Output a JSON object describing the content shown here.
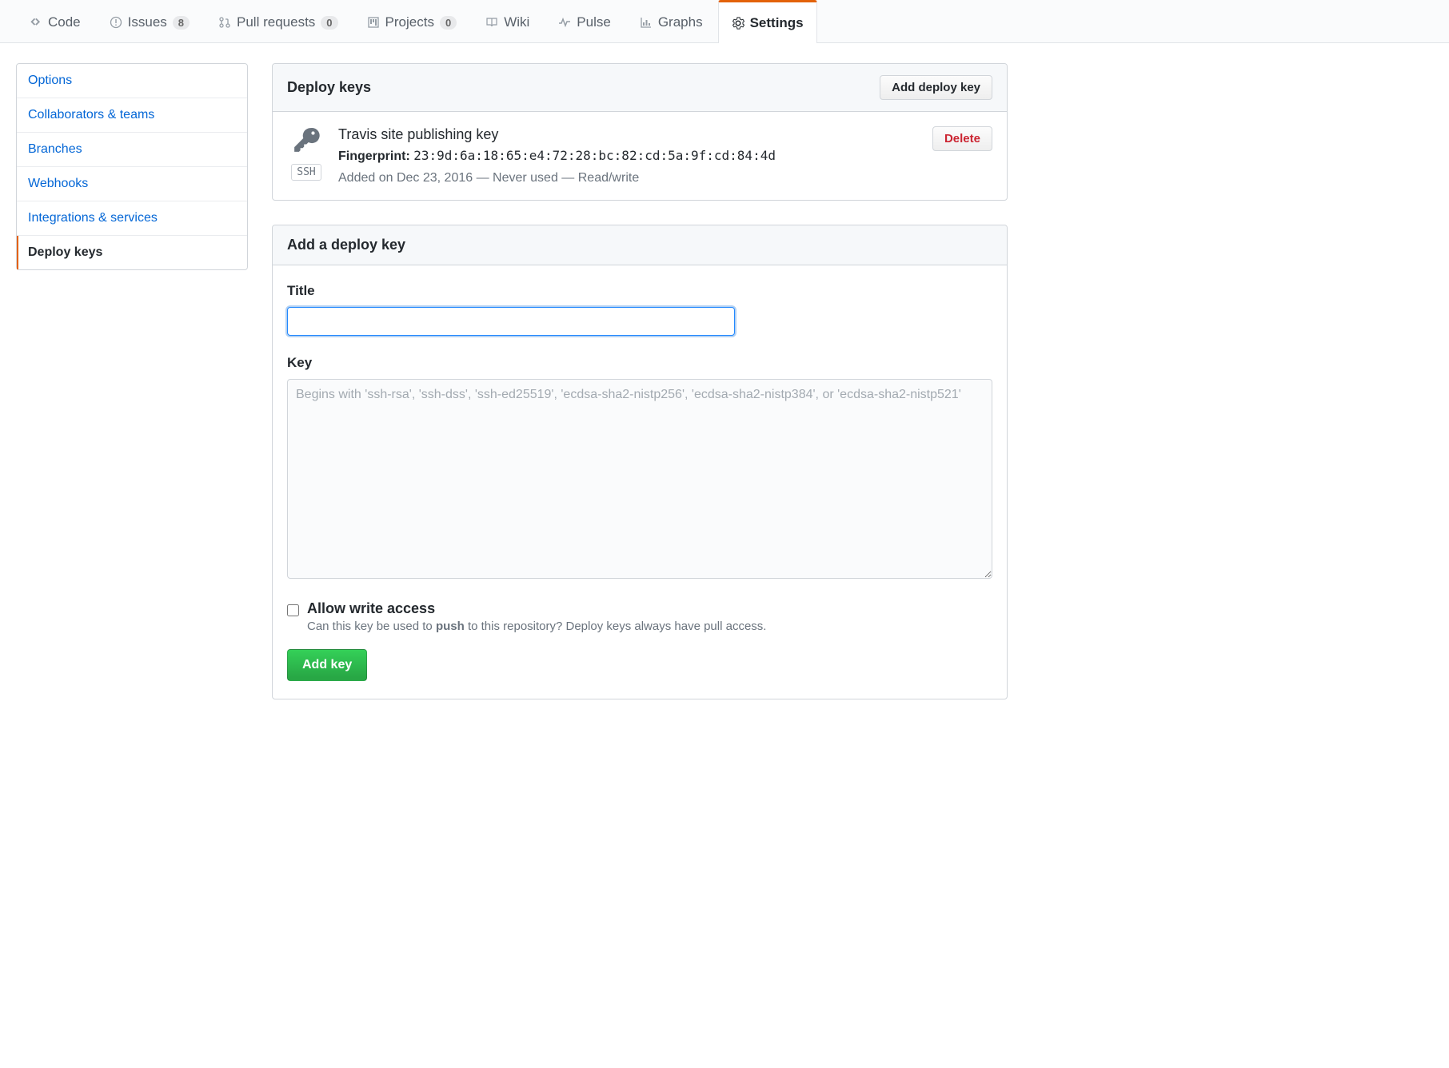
{
  "tabs": {
    "code": "Code",
    "issues": "Issues",
    "issues_count": "8",
    "pull_requests": "Pull requests",
    "pull_requests_count": "0",
    "projects": "Projects",
    "projects_count": "0",
    "wiki": "Wiki",
    "pulse": "Pulse",
    "graphs": "Graphs",
    "settings": "Settings"
  },
  "sidebar": {
    "options": "Options",
    "collaborators": "Collaborators & teams",
    "branches": "Branches",
    "webhooks": "Webhooks",
    "integrations": "Integrations & services",
    "deploy_keys": "Deploy keys"
  },
  "keys_panel": {
    "title": "Deploy keys",
    "add_button": "Add deploy key",
    "key": {
      "name": "Travis site publishing key",
      "fp_label": "Fingerprint:",
      "fp_value": "23:9d:6a:18:65:e4:72:28:bc:82:cd:5a:9f:cd:84:4d",
      "meta": "Added on Dec 23, 2016 — Never used — Read/write",
      "badge": "SSH",
      "delete": "Delete"
    }
  },
  "add_panel": {
    "title": "Add a deploy key",
    "title_label": "Title",
    "key_label": "Key",
    "key_placeholder": "Begins with 'ssh-rsa', 'ssh-dss', 'ssh-ed25519', 'ecdsa-sha2-nistp256', 'ecdsa-sha2-nistp384', or 'ecdsa-sha2-nistp521'",
    "allow_write": "Allow write access",
    "allow_write_desc_pre": "Can this key be used to ",
    "allow_write_desc_bold": "push",
    "allow_write_desc_post": " to this repository? Deploy keys always have pull access.",
    "submit": "Add key"
  }
}
